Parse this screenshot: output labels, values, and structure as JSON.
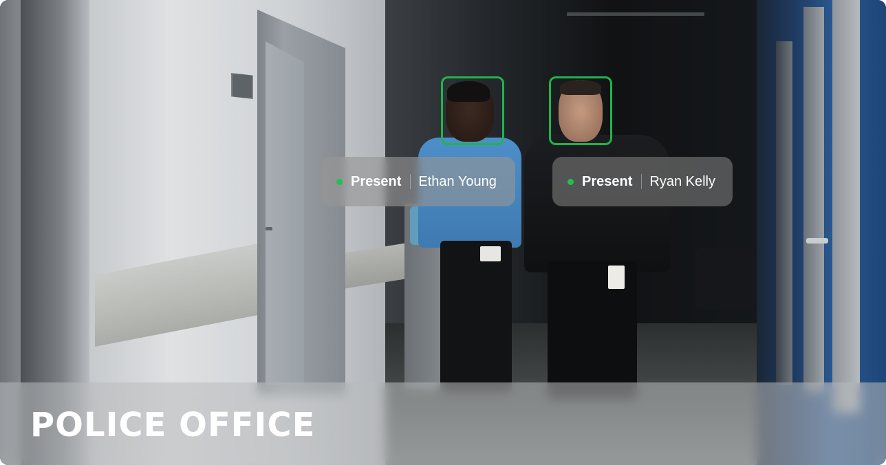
{
  "detections": [
    {
      "status": "Present",
      "name": "Ethan Young",
      "status_color": "#22c04e",
      "box_color": "#1fb54a"
    },
    {
      "status": "Present",
      "name": "Ryan Kelly",
      "status_color": "#22c04e",
      "box_color": "#1fb54a"
    }
  ],
  "footer": {
    "location_title": "POLICE OFFICE"
  }
}
